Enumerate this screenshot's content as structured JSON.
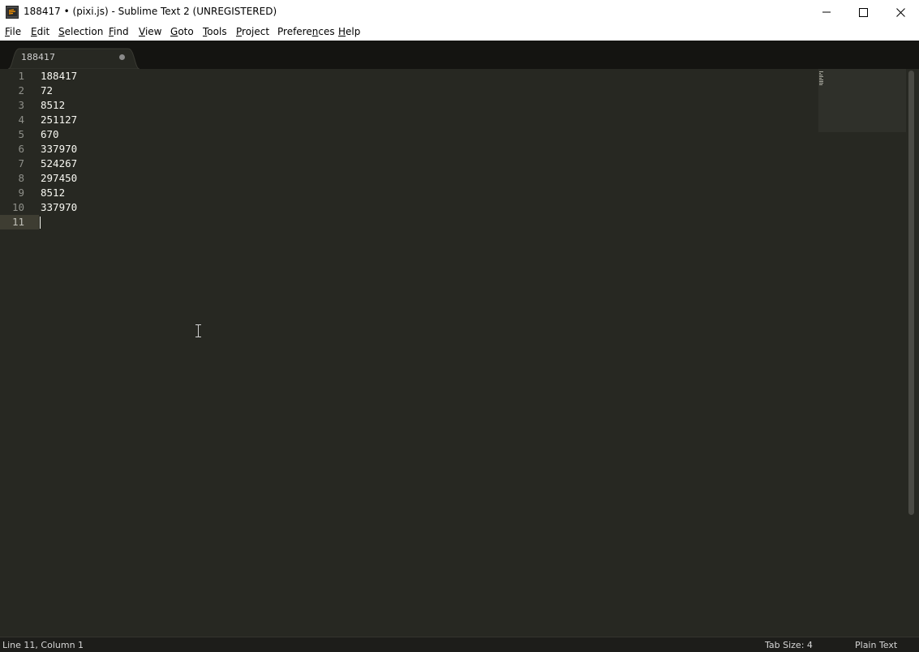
{
  "window": {
    "title": "188417 • (pixi.js) - Sublime Text 2 (UNREGISTERED)",
    "icon": "sublime-text-icon"
  },
  "menu": [
    {
      "label": "File",
      "key": "F",
      "rest": "ile"
    },
    {
      "label": "Edit",
      "key": "E",
      "rest": "dit"
    },
    {
      "label": "Selection",
      "key": "S",
      "rest": "election"
    },
    {
      "label": "Find",
      "key": "F",
      "rest": "ind",
      "prefix": ""
    },
    {
      "label": "View",
      "key": "V",
      "rest": "iew"
    },
    {
      "label": "Goto",
      "key": "G",
      "rest": "oto"
    },
    {
      "label": "Tools",
      "key": "T",
      "rest": "ools"
    },
    {
      "label": "Project",
      "key": "P",
      "rest": "roject"
    },
    {
      "label": "Preferences",
      "key": "n",
      "prefix": "Prefere",
      "rest": "ces"
    },
    {
      "label": "Help",
      "key": "H",
      "rest": "elp"
    }
  ],
  "tab": {
    "label": "188417",
    "dirty": true
  },
  "editor": {
    "lines": [
      "188417",
      "72",
      "8512",
      "251127",
      "670",
      "337970",
      "524267",
      "297450",
      "8512",
      "337970",
      ""
    ],
    "current_line": 11
  },
  "status": {
    "position": "Line 11, Column 1",
    "tab_size": "Tab Size: 4",
    "syntax": "Plain Text"
  },
  "colors": {
    "editor_bg": "#272822",
    "text": "#f8f8f2",
    "line_number": "#8f908a",
    "tab_bar": "#141411"
  }
}
